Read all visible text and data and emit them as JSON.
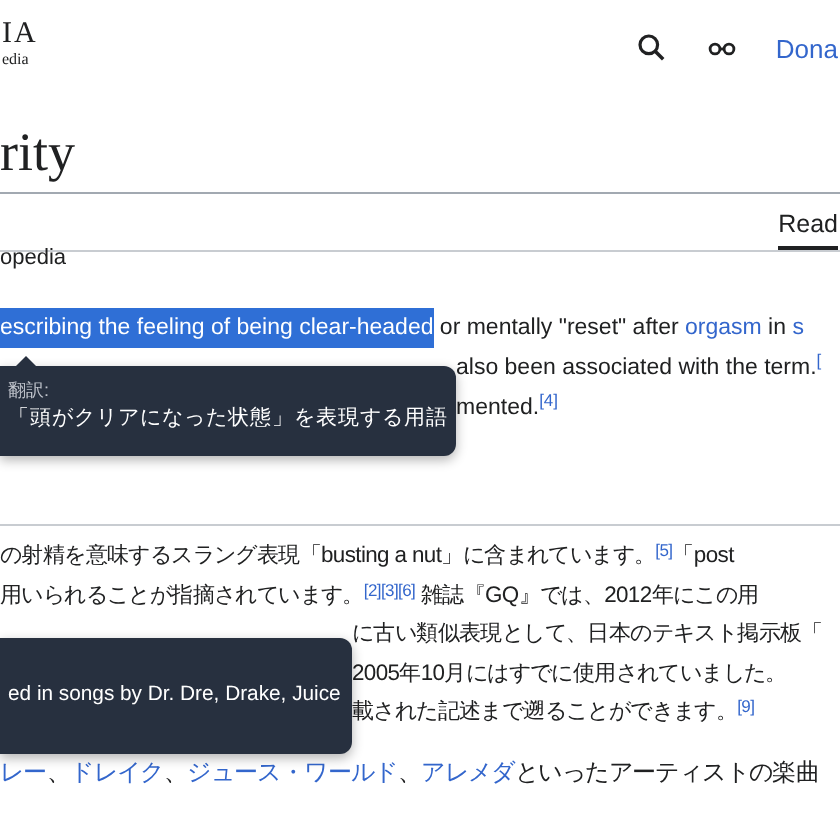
{
  "header": {
    "logo": "IA",
    "logo_subtitle": "edia",
    "donate_link": "Dona"
  },
  "title": "rity",
  "tabs": [
    {
      "label": "Read",
      "selected": true
    }
  ],
  "subtitle": "opedia",
  "english_lines": [
    [
      {
        "kind": "selection",
        "text": "escribing the feeling of being clear-headed"
      },
      {
        "kind": "text",
        "text": " or mentally \"reset\" after "
      },
      {
        "kind": "link",
        "text": "orgasm"
      },
      {
        "kind": "text",
        "text": " in "
      },
      {
        "kind": "link",
        "text": "s"
      }
    ],
    [
      {
        "kind": "text",
        "text": "also been associated with the term."
      },
      {
        "kind": "ref",
        "text": "["
      }
    ],
    [
      {
        "kind": "text",
        "text": "mented."
      },
      {
        "kind": "ref",
        "text": "[4]"
      }
    ]
  ],
  "japanese_lines": [
    [
      {
        "kind": "text",
        "text": "の射精を意味するスラング表現「busting a nut」に含まれています。"
      },
      {
        "kind": "ref",
        "text": "[5]"
      },
      {
        "kind": "text",
        "text": "「post"
      }
    ],
    [
      {
        "kind": "text",
        "text": "用いられることが指摘されています。"
      },
      {
        "kind": "ref",
        "text": "[2][3][6]"
      },
      {
        "kind": "text",
        "text": " 雑誌『GQ』では、2012年にこの用"
      }
    ],
    [
      {
        "kind": "text",
        "text": "に古い類似表現として、日本のテキスト掲示板「"
      }
    ],
    [
      {
        "kind": "text",
        "text": "2005年10月にはすでに使用されていました。"
      }
    ],
    [
      {
        "kind": "text",
        "text": "載された記述まで遡ることができます。"
      },
      {
        "kind": "ref",
        "text": "[9]"
      }
    ]
  ],
  "artists_line": [
    {
      "kind": "link",
      "text": "レー"
    },
    {
      "kind": "text",
      "text": "、"
    },
    {
      "kind": "link",
      "text": "ドレイク"
    },
    {
      "kind": "text",
      "text": "、"
    },
    {
      "kind": "link",
      "text": "ジュース・ワールド"
    },
    {
      "kind": "text",
      "text": "、"
    },
    {
      "kind": "link",
      "text": "アレメダ"
    },
    {
      "kind": "text",
      "text": "といったアーティストの楽曲"
    }
  ],
  "tooltips": [
    {
      "label": "翻訳:",
      "text": "「頭がクリアになった状態」を表現する用語"
    },
    {
      "text": "ed in songs by Dr. Dre, Drake, Juice"
    }
  ]
}
